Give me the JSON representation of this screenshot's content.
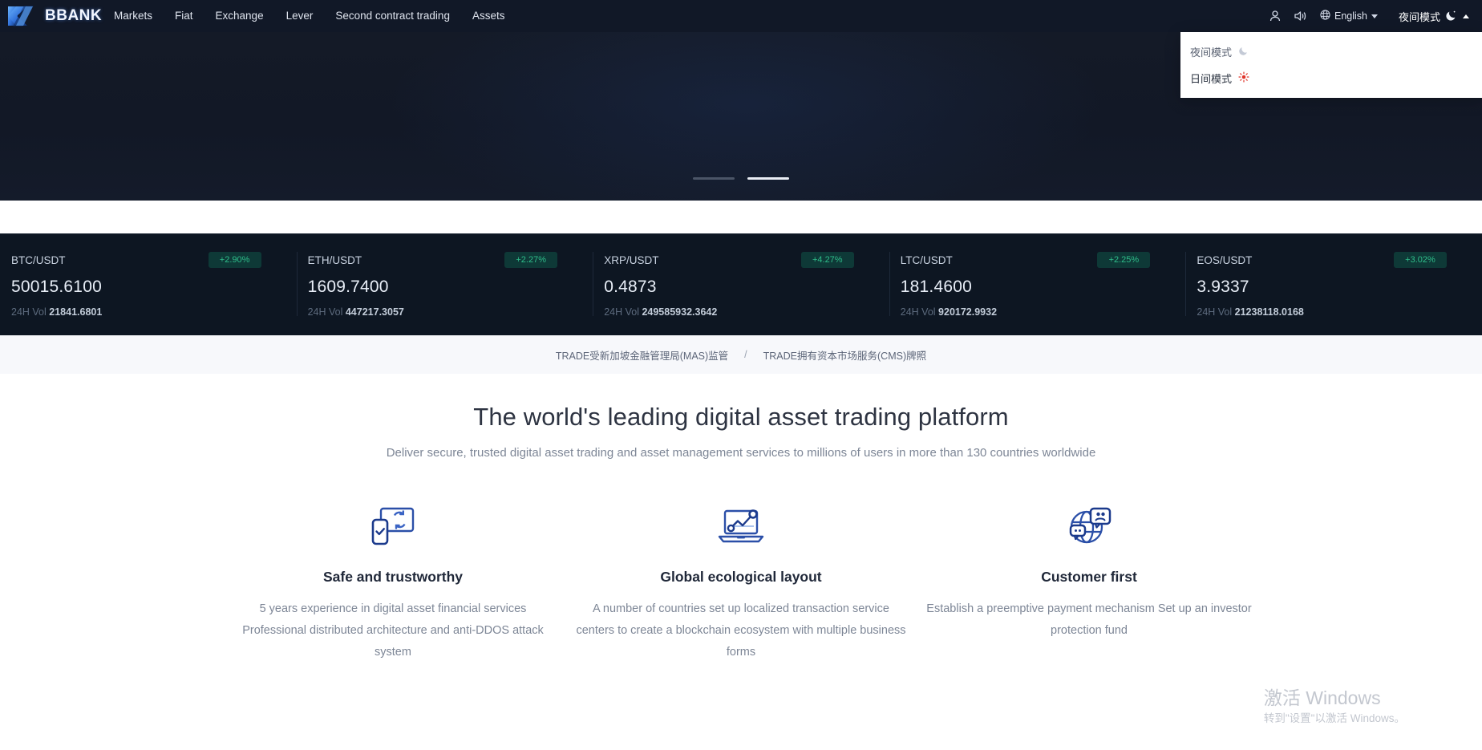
{
  "header": {
    "logo_text": "BBANK",
    "logo_icon": "k-logo-icon",
    "nav": [
      {
        "label": "Markets"
      },
      {
        "label": "Fiat"
      },
      {
        "label": "Exchange"
      },
      {
        "label": "Lever"
      },
      {
        "label": "Second contract trading"
      },
      {
        "label": "Assets"
      }
    ],
    "account_icon": "user-icon",
    "sound_icon": "speaker-icon",
    "globe_icon": "globe-icon",
    "language": "English",
    "theme_label": "夜间模式",
    "theme_icon": "moon-icon"
  },
  "theme_menu": {
    "items": [
      {
        "label": "夜间模式",
        "icon": "moon-icon",
        "active": false
      },
      {
        "label": "日间模式",
        "icon": "sun-icon",
        "active": true
      }
    ]
  },
  "hero": {
    "carousel_dots": 2,
    "active_dot": 2
  },
  "ticker": {
    "vol_label": "24H Vol",
    "items": [
      {
        "pair": "BTC/USDT",
        "change": "+2.90%",
        "price": "50015.6100",
        "volume": "21841.6801"
      },
      {
        "pair": "ETH/USDT",
        "change": "+2.27%",
        "price": "1609.7400",
        "volume": "447217.3057"
      },
      {
        "pair": "XRP/USDT",
        "change": "+4.27%",
        "price": "0.4873",
        "volume": "249585932.3642"
      },
      {
        "pair": "LTC/USDT",
        "change": "+2.25%",
        "price": "181.4600",
        "volume": "920172.9932"
      },
      {
        "pair": "EOS/USDT",
        "change": "+3.02%",
        "price": "3.9337",
        "volume": "21238118.0168"
      }
    ]
  },
  "regulation": {
    "left": "TRADE受新加坡金融管理局(MAS)监管",
    "separator": "/",
    "right": "TRADE拥有资本市场服务(CMS)牌照"
  },
  "main": {
    "title": "The world's leading digital asset trading platform",
    "subtitle": "Deliver secure, trusted digital asset trading and asset management services to millions of users in more than 130 countries worldwide",
    "features": [
      {
        "icon": "monitor-sync-phone-icon",
        "title": "Safe and trustworthy",
        "desc": "5 years experience in digital asset financial services Professional distributed architecture and anti-DDOS attack system"
      },
      {
        "icon": "laptop-chart-icon",
        "title": "Global ecological layout",
        "desc": "A number of countries set up localized transaction service centers to create a blockchain ecosystem with multiple business forms"
      },
      {
        "icon": "globe-support-chat-icon",
        "title": "Customer first",
        "desc": "Establish a preemptive payment mechanism Set up an investor protection fund"
      }
    ]
  },
  "watermark": {
    "line1": "激活 Windows",
    "line2": "转到\"设置\"以激活 Windows。"
  },
  "colors": {
    "header_bg": "#111827",
    "hero_bg": "#141a27",
    "ticker_bg": "#0d1622",
    "up_green": "#2fbd8a",
    "brand_blue": "#2b4fa8",
    "reg_bg": "#f7f8fb"
  }
}
